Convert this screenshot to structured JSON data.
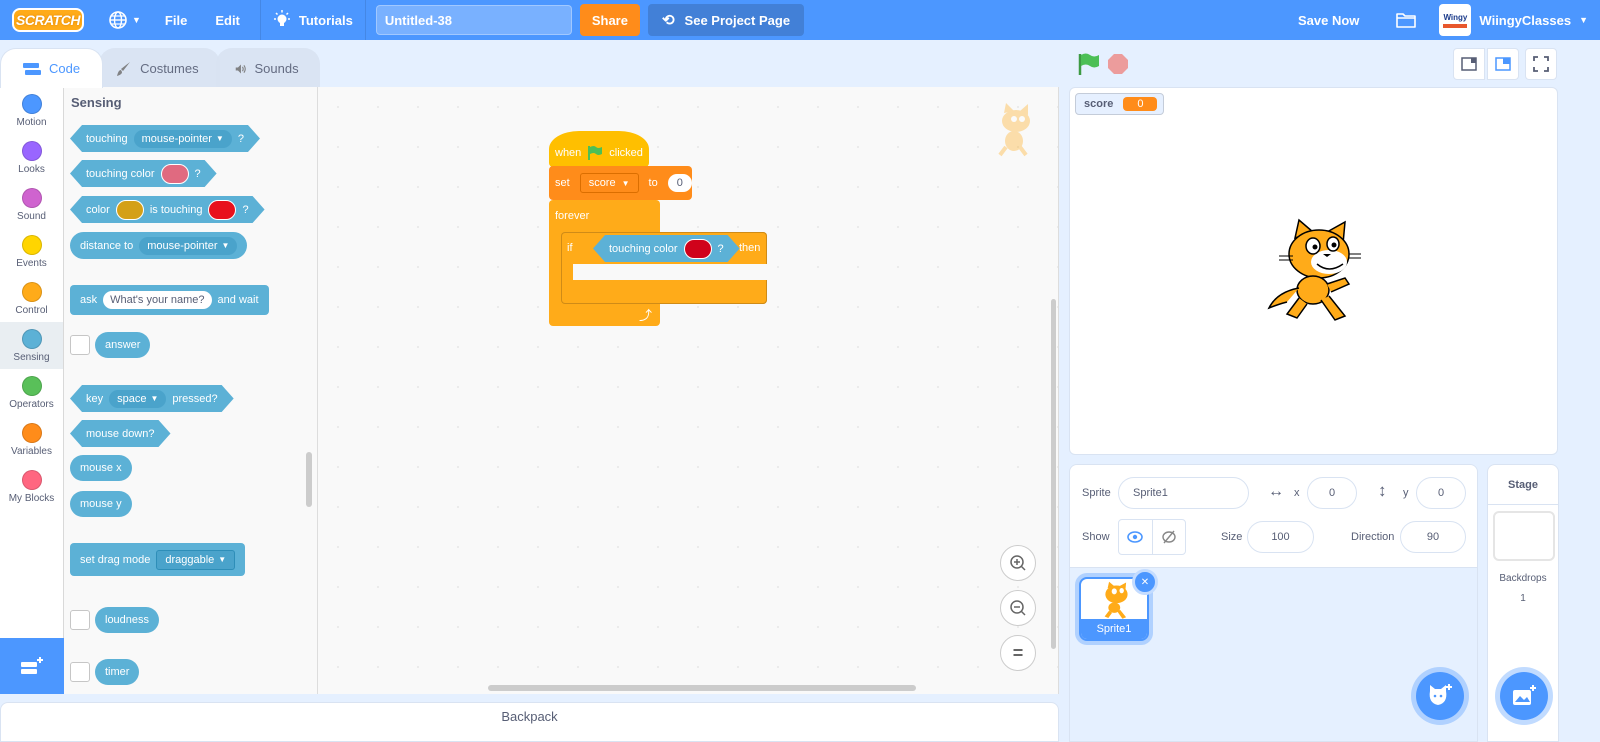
{
  "menubar": {
    "logo": "SCRATCH",
    "file": "File",
    "edit": "Edit",
    "tutorials": "Tutorials",
    "project_title": "Untitled-38",
    "share": "Share",
    "see_project_page": "See Project Page",
    "save_now": "Save Now",
    "avatar_text": "Wingy",
    "username": "WiingyClasses"
  },
  "tabs": [
    {
      "label": "Code",
      "active": true
    },
    {
      "label": "Costumes",
      "active": false
    },
    {
      "label": "Sounds",
      "active": false
    }
  ],
  "categories": [
    {
      "label": "Motion",
      "color": "#4c97ff"
    },
    {
      "label": "Looks",
      "color": "#9966ff"
    },
    {
      "label": "Sound",
      "color": "#cf63cf"
    },
    {
      "label": "Events",
      "color": "#ffd500"
    },
    {
      "label": "Control",
      "color": "#ffab19"
    },
    {
      "label": "Sensing",
      "color": "#5cb1d6",
      "active": true
    },
    {
      "label": "Operators",
      "color": "#59c059"
    },
    {
      "label": "Variables",
      "color": "#ff8c1a"
    },
    {
      "label": "My Blocks",
      "color": "#ff6680"
    }
  ],
  "flyout": {
    "title": "Sensing",
    "touching": {
      "label": "touching",
      "dropdown": "mouse-pointer",
      "suffix": "?"
    },
    "touching_color": {
      "label": "touching color",
      "color": "#e06a80",
      "suffix": "?"
    },
    "color_touching": {
      "label": "color",
      "color1": "#d4a017",
      "mid": "is touching",
      "color2": "#e8101c",
      "suffix": "?"
    },
    "distance_to": {
      "label": "distance to",
      "dropdown": "mouse-pointer"
    },
    "ask": {
      "label": "ask",
      "input": "What's your name?",
      "suffix": "and wait"
    },
    "answer": "answer",
    "key_pressed": {
      "label": "key",
      "dropdown": "space",
      "suffix": "pressed?"
    },
    "mouse_down": "mouse down?",
    "mouse_x": "mouse x",
    "mouse_y": "mouse y",
    "drag_mode": {
      "label": "set drag mode",
      "dropdown": "draggable"
    },
    "loudness": "loudness",
    "timer": "timer"
  },
  "script": {
    "hat": {
      "when": "when",
      "clicked": "clicked"
    },
    "set": {
      "label": "set",
      "variable": "score",
      "to": "to",
      "value": "0"
    },
    "forever": "forever",
    "if": {
      "label": "if",
      "condition": "touching color",
      "color": "#d0021b",
      "q": "?",
      "then": "then"
    }
  },
  "backpack": "Backpack",
  "stage": {
    "monitor": {
      "name": "score",
      "value": "0"
    }
  },
  "sprite_info": {
    "sprite_label": "Sprite",
    "sprite_name": "Sprite1",
    "x_label": "x",
    "x": "0",
    "y_label": "y",
    "y": "0",
    "show_label": "Show",
    "size_label": "Size",
    "size": "100",
    "direction_label": "Direction",
    "direction": "90"
  },
  "sprites": [
    {
      "name": "Sprite1",
      "selected": true
    }
  ],
  "stage_pane": {
    "title": "Stage",
    "backdrops_label": "Backdrops",
    "backdrops_count": "1"
  }
}
